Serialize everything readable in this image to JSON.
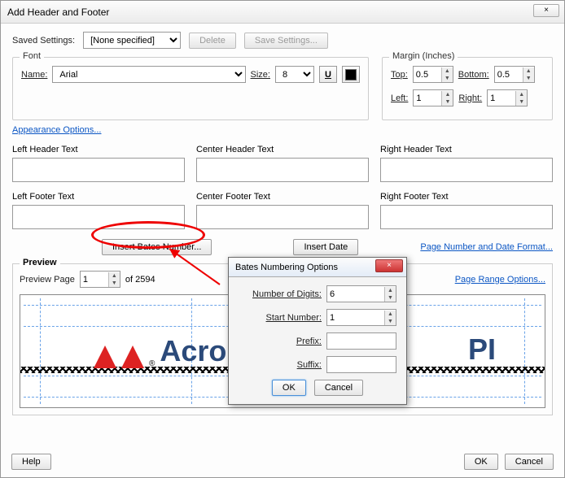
{
  "window": {
    "title": "Add Header and Footer",
    "close": "×"
  },
  "saved": {
    "label": "Saved Settings:",
    "value": "[None specified]",
    "delete": "Delete",
    "save": "Save Settings..."
  },
  "font": {
    "legend": "Font",
    "name_label": "Name:",
    "name": "Arial",
    "size_label": "Size:",
    "size": "8",
    "underline": "U"
  },
  "margin": {
    "legend": "Margin (Inches)",
    "top_label": "Top:",
    "top": "0.5",
    "bottom_label": "Bottom:",
    "bottom": "0.5",
    "left_label": "Left:",
    "left": "1",
    "right_label": "Right:",
    "right": "1"
  },
  "appearance_link": "Appearance Options...",
  "headers": {
    "lh": "Left Header Text",
    "ch": "Center Header Text",
    "rh": "Right Header Text",
    "lf": "Left Footer Text",
    "cf": "Center Footer Text",
    "rf": "Right Footer Text"
  },
  "mid": {
    "bates": "Insert Bates Number...",
    "date": "Insert Date",
    "format_link": "Page Number and Date Format..."
  },
  "preview": {
    "legend": "Preview",
    "page_label": "Preview Page",
    "page": "1",
    "total": "of 2594",
    "range_link": "Page Range Options...",
    "logo_text": "Acro",
    "logo_text2": "PI"
  },
  "footer": {
    "help": "Help",
    "ok": "OK",
    "cancel": "Cancel"
  },
  "modal": {
    "title": "Bates Numbering Options",
    "digits_label": "Number of Digits:",
    "digits": "6",
    "start_label": "Start Number:",
    "start": "1",
    "prefix_label": "Prefix:",
    "prefix": "",
    "suffix_label": "Suffix:",
    "suffix": "",
    "ok": "OK",
    "cancel": "Cancel",
    "close": "×"
  }
}
